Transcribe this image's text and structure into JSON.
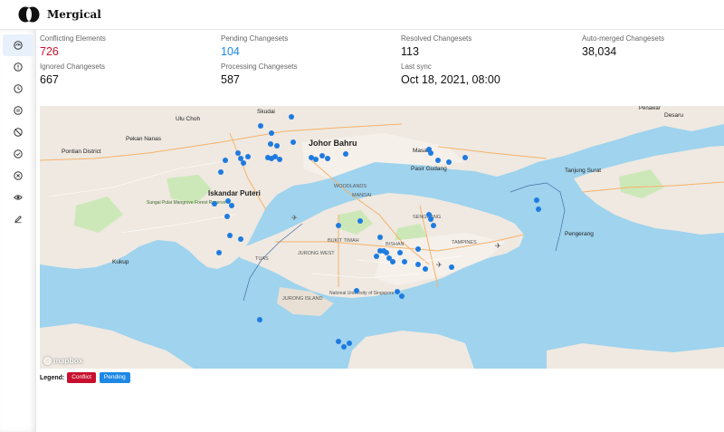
{
  "app": {
    "brand": "Mergical"
  },
  "sidebar": {
    "items": [
      {
        "icon": "dashboard-icon",
        "active": true
      },
      {
        "icon": "alert-circle-icon",
        "active": false
      },
      {
        "icon": "clock-icon",
        "active": false
      },
      {
        "icon": "pause-circle-icon",
        "active": false
      },
      {
        "icon": "ban-icon",
        "active": false
      },
      {
        "icon": "check-circle-icon",
        "active": false
      },
      {
        "icon": "close-circle-icon",
        "active": false
      },
      {
        "icon": "eye-icon",
        "active": false
      },
      {
        "icon": "pencil-icon",
        "active": false
      }
    ]
  },
  "stats": {
    "conflicting": {
      "label": "Conflicting Elements",
      "value": "726",
      "color": "#c8102e"
    },
    "pending": {
      "label": "Pending Changesets",
      "value": "104",
      "color": "#1e88e5"
    },
    "resolved": {
      "label": "Resolved Changesets",
      "value": "113"
    },
    "automerged": {
      "label": "Auto-merged Changesets",
      "value": "38,034"
    },
    "ignored": {
      "label": "Ignored Changesets",
      "value": "667"
    },
    "processing": {
      "label": "Processing Changesets",
      "value": "587"
    },
    "lastsync": {
      "label": "Last sync",
      "value": "Oct 18, 2021, 08:00"
    }
  },
  "map": {
    "attribution": "mapbox",
    "place_labels": [
      "Johor Bahru",
      "Iskandar Puteri",
      "Pasir Gudang",
      "Masai",
      "Skudai",
      "Ulu Choh",
      "Pekan Nanas",
      "Pontian District",
      "Kukup",
      "Tanjung Surat",
      "Pengerang",
      "Desaru",
      "Penawar",
      "Sungai Pulai Mangrove Forest Reserve",
      "National University of Singapore",
      "WOODLANDS",
      "MANDAI",
      "BUKIT TIMAH",
      "JURONG WEST",
      "BISHAN",
      "SENGKANG",
      "TAMPINES",
      "TUAS",
      "JURONG ISLAND"
    ],
    "marker_color": "#1e7be0"
  },
  "legend": {
    "title": "Legend:",
    "conflict": {
      "label": "Conflict",
      "color": "#c8102e"
    },
    "pending": {
      "label": "Pending",
      "color": "#1e88e5"
    }
  }
}
